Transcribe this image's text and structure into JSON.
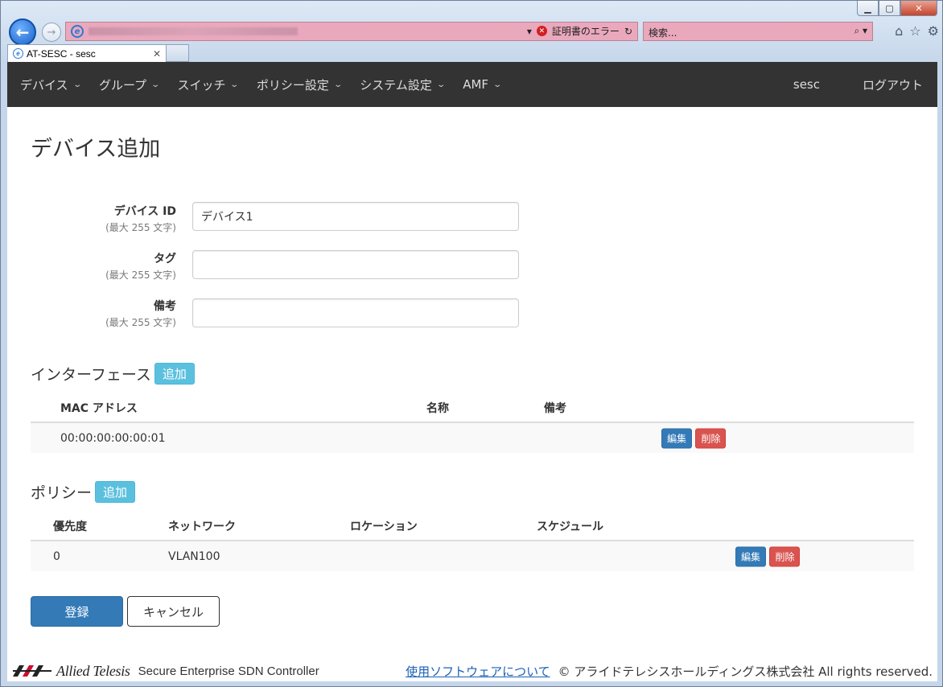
{
  "browser": {
    "address_cert_error": "証明書のエラー",
    "search_placeholder": "検索...",
    "tab_title": "AT-SESC - sesc"
  },
  "navbar": {
    "items": [
      {
        "label": "デバイス"
      },
      {
        "label": "グループ"
      },
      {
        "label": "スイッチ"
      },
      {
        "label": "ポリシー設定"
      },
      {
        "label": "システム設定"
      },
      {
        "label": "AMF"
      }
    ],
    "user": "sesc",
    "logout": "ログアウト"
  },
  "page": {
    "title": "デバイス追加"
  },
  "form": {
    "device_id": {
      "label": "デバイス ID",
      "hint": "(最大 255 文字)",
      "value": "デバイス1"
    },
    "tag": {
      "label": "タグ",
      "hint": "(最大 255 文字)",
      "value": ""
    },
    "note": {
      "label": "備考",
      "hint": "(最大 255 文字)",
      "value": ""
    }
  },
  "interfaces": {
    "title": "インターフェース",
    "add_label": "追加",
    "columns": [
      "MAC アドレス",
      "名称",
      "備考"
    ],
    "rows": [
      {
        "mac": "00:00:00:00:00:01",
        "name": "",
        "note": "",
        "edit": "編集",
        "delete": "削除"
      }
    ]
  },
  "policies": {
    "title": "ポリシー",
    "add_label": "追加",
    "columns": [
      "優先度",
      "ネットワーク",
      "ロケーション",
      "スケジュール"
    ],
    "rows": [
      {
        "priority": "0",
        "network": "VLAN100",
        "location": "",
        "schedule": "",
        "edit": "編集",
        "delete": "削除"
      }
    ]
  },
  "actions": {
    "submit": "登録",
    "cancel": "キャンセル"
  },
  "footer": {
    "logo_text": "Allied Telesis",
    "product": "Secure Enterprise SDN Controller",
    "link": "使用ソフトウェアについて",
    "copyright": "© アライドテレシスホールディングス株式会社 All rights reserved."
  }
}
